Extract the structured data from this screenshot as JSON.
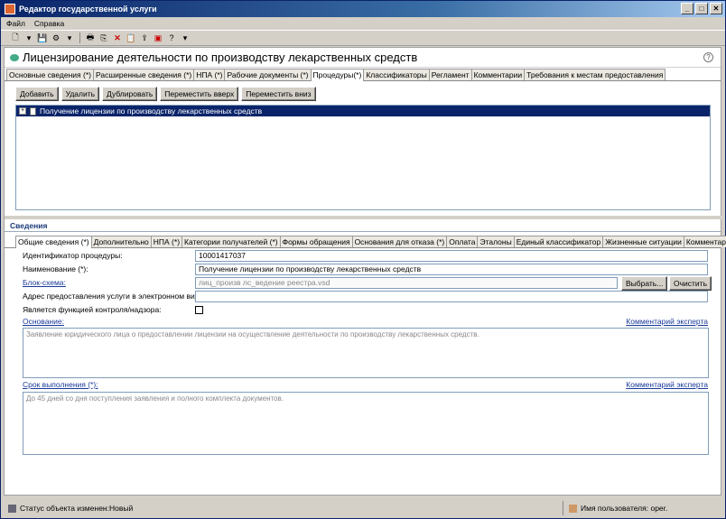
{
  "window": {
    "title": "Редактор государственной услуги"
  },
  "menu": [
    "Файл",
    "Справка"
  ],
  "toolbar": {
    "icons": [
      "new-icon",
      "save-icon",
      "settings-icon",
      "print-icon",
      "delete-icon",
      "copy-icon",
      "export-icon",
      "pdf-icon",
      "help-icon"
    ]
  },
  "page": {
    "title": "Лицензирование деятельности по производству лекарственных средств",
    "help": "?"
  },
  "tabs": [
    "Основные сведения (*)",
    "Расширенные сведения (*)",
    "НПА (*)",
    "Рабочие документы (*)",
    "Процедуры(*)",
    "Классификаторы",
    "Регламент",
    "Комментарии",
    "Требования к местам предоставления"
  ],
  "active_tab": 4,
  "buttons": {
    "add": "Добавить",
    "delete": "Удалить",
    "duplicate": "Дублировать",
    "up": "Переместить вверх",
    "down": "Переместить вниз"
  },
  "tree": {
    "item": "Получение лицензии по производству лекарственных средств",
    "expander": "+"
  },
  "section": {
    "title": "Сведения"
  },
  "subtabs": [
    "Общие сведения (*)",
    "Дополнительно",
    "НПА (*)",
    "Категории получателей (*)",
    "Формы обращения",
    "Основания для отказа (*)",
    "Оплата",
    "Эталоны",
    "Единый классификатор",
    "Жизненные ситуации",
    "Комментарии"
  ],
  "form": {
    "id_label": "Идентификатор процедуры:",
    "id_value": "10001417037",
    "name_label": "Наименование (*):",
    "name_value": "Получение лицензии по производству лекарственных средств",
    "scheme_label": "Блок-схема:",
    "scheme_value": "лиц_произв лс_ведение реестра.vsd",
    "choose_btn": "Выбрать...",
    "clear_btn": "Очистить",
    "address_label": "Адрес предоставления услуги в электронном виде:",
    "address_value": "",
    "control_label": "Является функцией контроля/надзора:",
    "basis_label": "Основание:",
    "basis_text": "Заявление юридического лица о предоставлении лицензии на осуществление деятельности по производству лекарственных средств.",
    "expert_comment": "Комментарий эксперта",
    "term_label": "Срок выполнения (*):",
    "term_text": "До 45 дней со дня поступления заявления и полного комплекта документов."
  },
  "status": {
    "left": "Статус объекта изменен:Новый",
    "right": "Имя пользователя: oper."
  }
}
